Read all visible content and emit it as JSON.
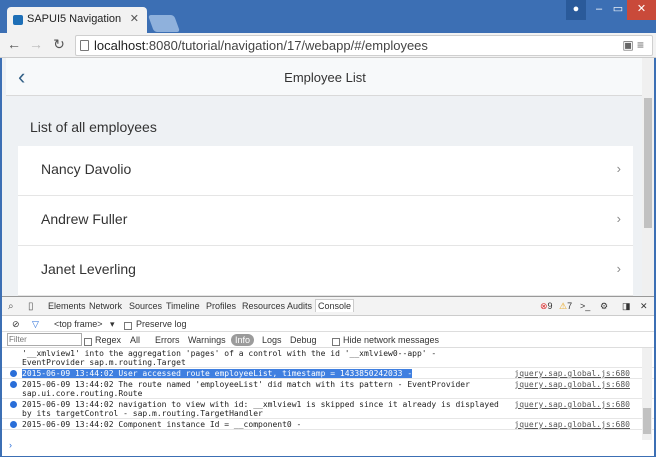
{
  "browser": {
    "tab_title": "SAPUI5 Navigation",
    "url_host": "localhost",
    "url_rest": ":8080/tutorial/navigation/17/webapp/#/employees"
  },
  "app": {
    "title": "Employee List",
    "subheader": "List of all employees",
    "employees": [
      "Nancy Davolio",
      "Andrew Fuller",
      "Janet Leverling"
    ]
  },
  "devtools": {
    "tabs": [
      "Elements",
      "Network",
      "Sources",
      "Timeline",
      "Profiles",
      "Resources",
      "Audits",
      "Console"
    ],
    "errors": "9",
    "warnings": "7",
    "context": "<top frame>",
    "preserve_log": "Preserve log",
    "filter_placeholder": "Filter",
    "regex": "Regex",
    "levels": [
      "All",
      "Errors",
      "Warnings",
      "Info",
      "Logs",
      "Debug"
    ],
    "hide_network": "Hide network messages",
    "logs": [
      {
        "msg": "'__xmlview1' into the aggregation 'pages' of a control with the id '__xmlview0--app' - EventProvider sap.m.routing.Target",
        "src": ""
      },
      {
        "msg": "2015-06-09 13:44:02 User accessed route employeeList, timestamp = 1433850242033 -",
        "src": "jquery.sap.global.js:680"
      },
      {
        "msg": "2015-06-09 13:44:02 The route named 'employeeList' did match with its pattern - EventProvider sap.ui.core.routing.Route",
        "src": "jquery.sap.global.js:680"
      },
      {
        "msg": "2015-06-09 13:44:02 navigation to view with id: __xmlview1 is skipped since it already is displayed by its targetControl - sap.m.routing.TargetHandler",
        "src": "jquery.sap.global.js:680"
      },
      {
        "msg": "2015-06-09 13:44:02 Component instance Id = __component0 -",
        "src": "jquery.sap.global.js:680"
      }
    ]
  }
}
